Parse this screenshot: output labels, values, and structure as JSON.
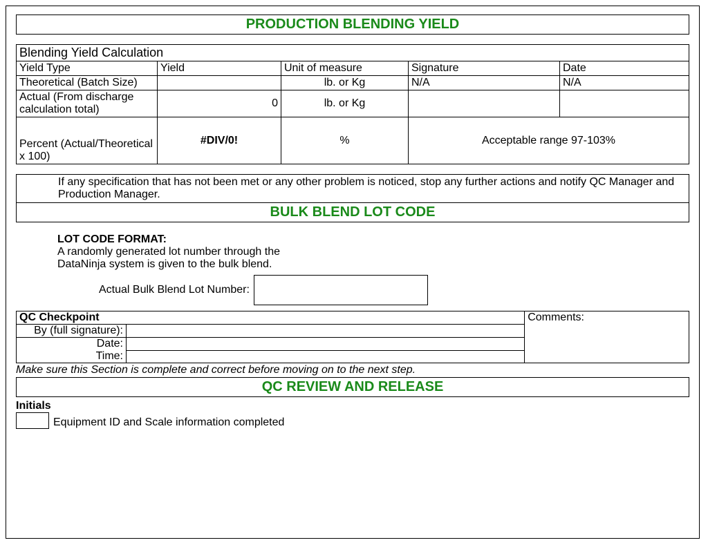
{
  "title1": "PRODUCTION BLENDING YIELD",
  "calc": {
    "caption": "Blending Yield Calculation",
    "headers": {
      "c1": "Yield Type",
      "c2": "Yield",
      "c3": "Unit of measure",
      "c4": "Signature",
      "c5": "Date"
    },
    "row1": {
      "c1": "Theoretical (Batch Size)",
      "c2": "",
      "c3": "lb. or Kg",
      "c4": "N/A",
      "c5": "N/A"
    },
    "row2": {
      "c1": "Actual (From discharge calculation total)",
      "c2": "0",
      "c3": "lb. or Kg",
      "c4": "",
      "c5": ""
    },
    "row3": {
      "c1": "Percent (Actual/Theoretical x 100)",
      "c2": "#DIV/0!",
      "c3": "%",
      "c45": "Acceptable range 97-103%"
    }
  },
  "spec_note": "If any specification that has not been met or any other problem is noticed, stop any further actions and notify QC Manager and Production Manager.",
  "title2": "BULK BLEND LOT CODE",
  "lot": {
    "hdr": "LOT CODE FORMAT:",
    "line1": "A randomly generated lot number through the",
    "line2": "DataNinja system is given to the bulk blend.",
    "label": "Actual Bulk Blend Lot Number:"
  },
  "qc": {
    "hdr": "QC Checkpoint",
    "comments": "Comments:",
    "by": "By (full signature):",
    "date": "Date:",
    "time": "Time:"
  },
  "note": "Make sure this Section is complete and correct before moving on to the next step.",
  "title3": "QC REVIEW AND RELEASE",
  "initials_hdr": "Initials",
  "equip_label": "Equipment ID and Scale information completed"
}
